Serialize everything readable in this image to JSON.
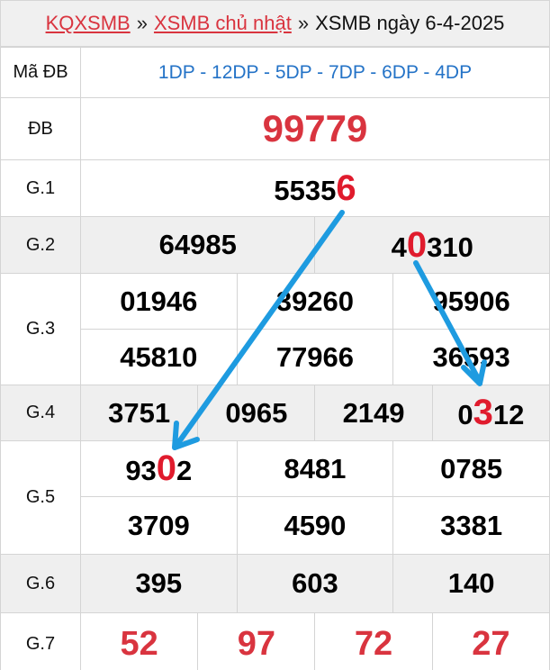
{
  "breadcrumb": {
    "home": "KQXSMB",
    "separator": "»",
    "section": "XSMB chủ nhật",
    "current": "XSMB ngày 6-4-2025"
  },
  "table": {
    "ma_db": {
      "label": "Mã ĐB",
      "value": "1DP - 12DP - 5DP - 7DP - 6DP - 4DP"
    },
    "db": {
      "label": "ĐB",
      "value": "99779"
    },
    "g1": {
      "label": "G.1",
      "pre": "5535",
      "hl": "6",
      "post": ""
    },
    "g2": {
      "label": "G.2",
      "n1": "64985",
      "n2": {
        "pre": "4",
        "hl": "0",
        "post": "310"
      }
    },
    "g3": {
      "label": "G.3",
      "values": [
        "01946",
        "39260",
        "95906",
        "45810",
        "77966",
        "36593"
      ]
    },
    "g4": {
      "label": "G.4",
      "values": [
        "3751",
        "0965",
        "2149"
      ],
      "last": {
        "pre": "0",
        "hl": "3",
        "post": "12"
      }
    },
    "g5": {
      "label": "G.5",
      "first": {
        "pre": "93",
        "hl": "0",
        "post": "2"
      },
      "values": [
        "8481",
        "0785",
        "3709",
        "4590",
        "3381"
      ]
    },
    "g6": {
      "label": "G.6",
      "values": [
        "395",
        "603",
        "140"
      ]
    },
    "g7": {
      "label": "G.7",
      "values": [
        "52",
        "97",
        "72",
        "27"
      ]
    }
  },
  "colors": {
    "accent_red": "#d9343f",
    "highlight_red": "#e01b2d",
    "blue_text": "#2473c7",
    "arrow_blue": "#1e9be0",
    "shade": "#efefef"
  }
}
